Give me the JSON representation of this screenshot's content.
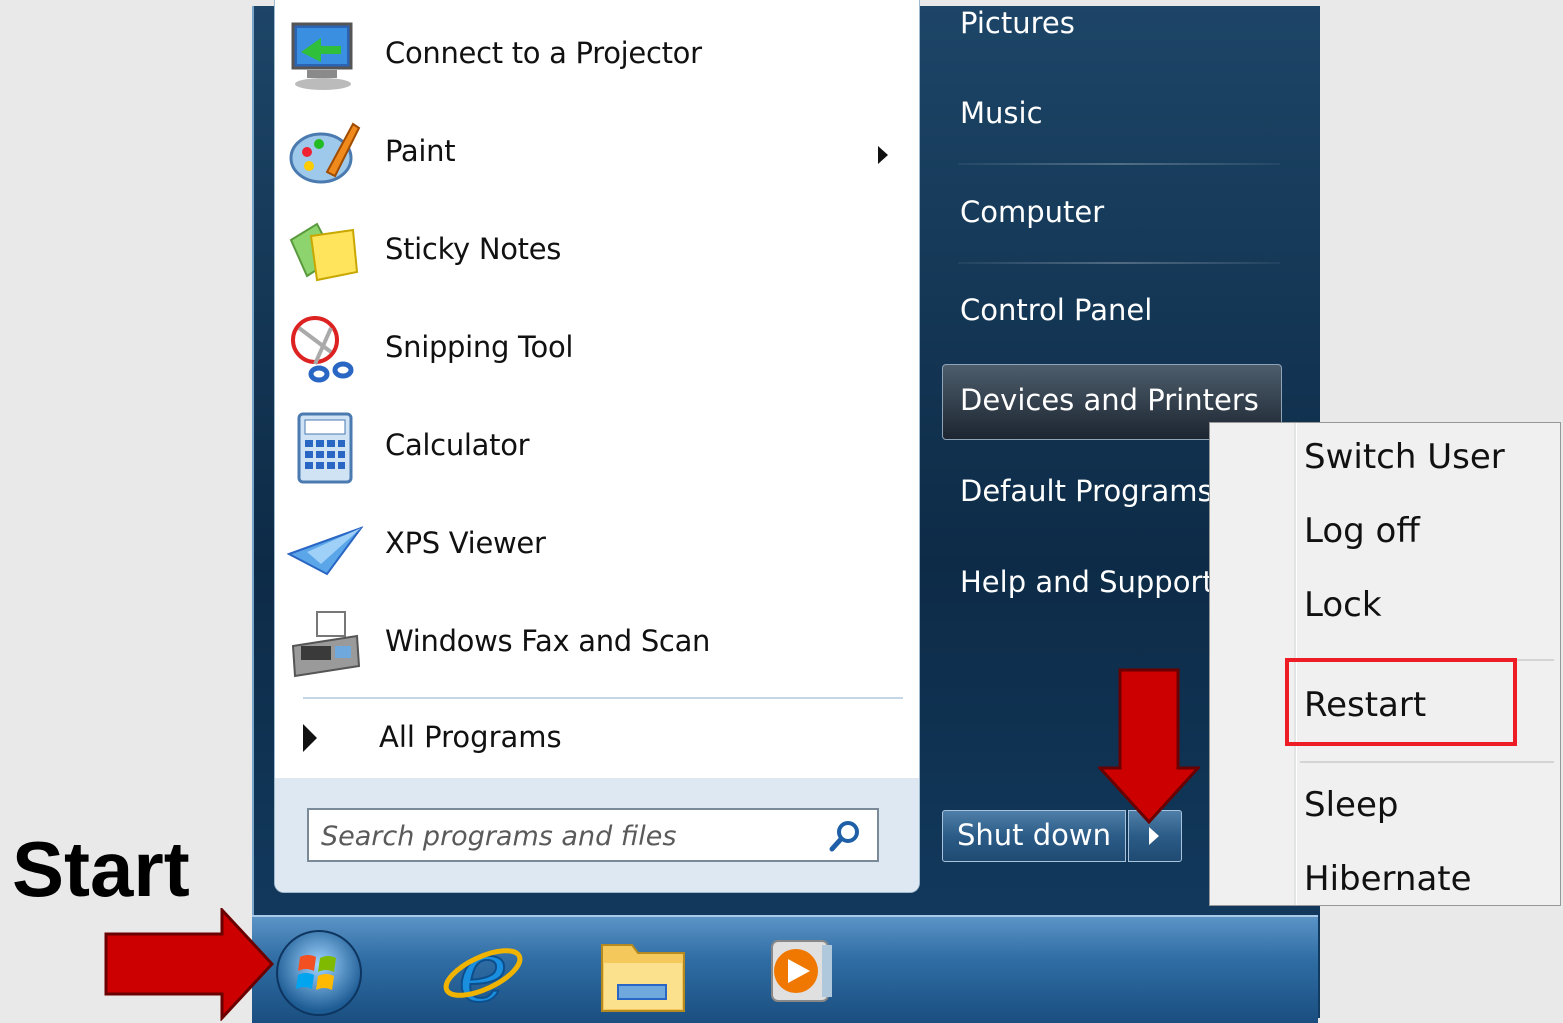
{
  "left_pane": {
    "programs": [
      {
        "label": "Connect to a Projector",
        "icon": "projector-icon",
        "has_submenu": false
      },
      {
        "label": "Paint",
        "icon": "paint-palette-icon",
        "has_submenu": true
      },
      {
        "label": "Sticky Notes",
        "icon": "sticky-notes-icon",
        "has_submenu": false
      },
      {
        "label": "Snipping Tool",
        "icon": "scissors-icon",
        "has_submenu": false
      },
      {
        "label": "Calculator",
        "icon": "calculator-icon",
        "has_submenu": false
      },
      {
        "label": "XPS Viewer",
        "icon": "paper-plane-icon",
        "has_submenu": false
      },
      {
        "label": "Windows Fax and Scan",
        "icon": "fax-icon",
        "has_submenu": false
      }
    ],
    "all_programs": "All Programs",
    "search_placeholder": "Search programs and files"
  },
  "right_pane": {
    "items": [
      "Pictures",
      "Music",
      "Computer",
      "Control Panel",
      "Devices and Printers",
      "Default Programs",
      "Help and Support"
    ],
    "highlighted": "Devices and Printers",
    "shutdown_label": "Shut down"
  },
  "power_menu": {
    "items": [
      "Switch User",
      "Log off",
      "Lock",
      "Restart",
      "Sleep",
      "Hibernate"
    ],
    "highlighted": "Restart"
  },
  "annotation": {
    "start_label": "Start"
  },
  "taskbar": {
    "icons": [
      "windows-start-orb-icon",
      "internet-explorer-icon",
      "windows-explorer-folder-icon",
      "media-player-icon"
    ]
  },
  "colors": {
    "annotation_red": "#cc0000",
    "highlight_box": "#ee1c25"
  }
}
